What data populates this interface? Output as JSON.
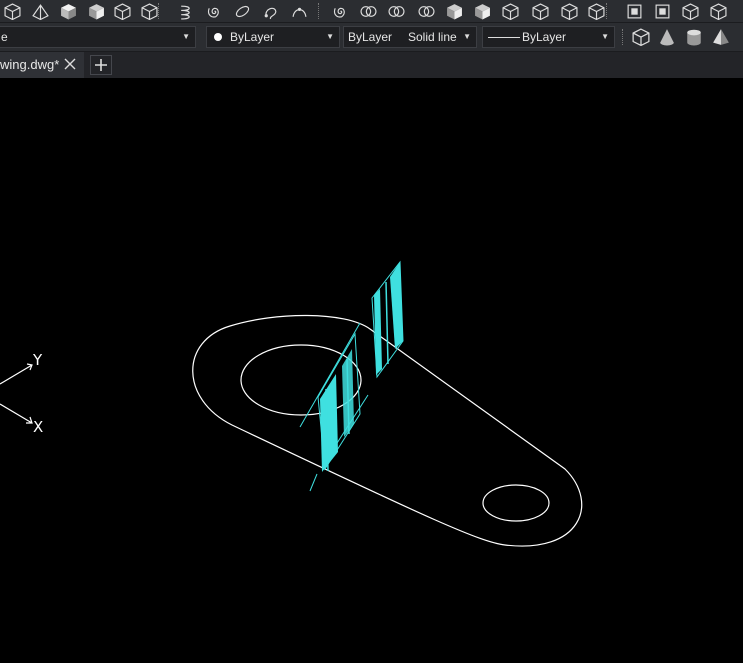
{
  "toolbar": {
    "icons": [
      "box-edge-icon",
      "wedge-outline-icon",
      "cube-solid-icon",
      "cube-shaded-icon",
      "cube-wire-icon",
      "cube-front-icon",
      "helix-icon",
      "spiral-icon",
      "ellipse-rotate-icon",
      "lasso-icon",
      "arc-point-icon",
      "swirl-icon",
      "union-icon",
      "intersect-icon",
      "subtract-icon",
      "box-gray-icon",
      "box-face-icon",
      "box-open-icon",
      "box-slice-icon",
      "box-array-icon",
      "box-lock-icon",
      "box-move-icon",
      "box-copy-icon",
      "frame-icon",
      "box-hinge-icon",
      "box-tree-icon",
      "sphere-link-icon"
    ]
  },
  "properties": {
    "layer_value": "e",
    "color_value": "ByLayer",
    "linetype_value": "ByLayer",
    "linetype_style": "Solid line",
    "lineweight_value": "ByLayer",
    "primitive_icons": [
      "box-primitive-icon",
      "cone-primitive-icon",
      "cylinder-primitive-icon",
      "pyramid-primitive-icon"
    ]
  },
  "tabs": {
    "active_name": "wing.dwg*",
    "new_tab_symbol": "+"
  },
  "viewport": {
    "background": "#000000",
    "geometry_color": "#ffffff",
    "highlight_color": "#3fe0e0",
    "ucs_y_label": "Y",
    "ucs_x_label": "X"
  }
}
